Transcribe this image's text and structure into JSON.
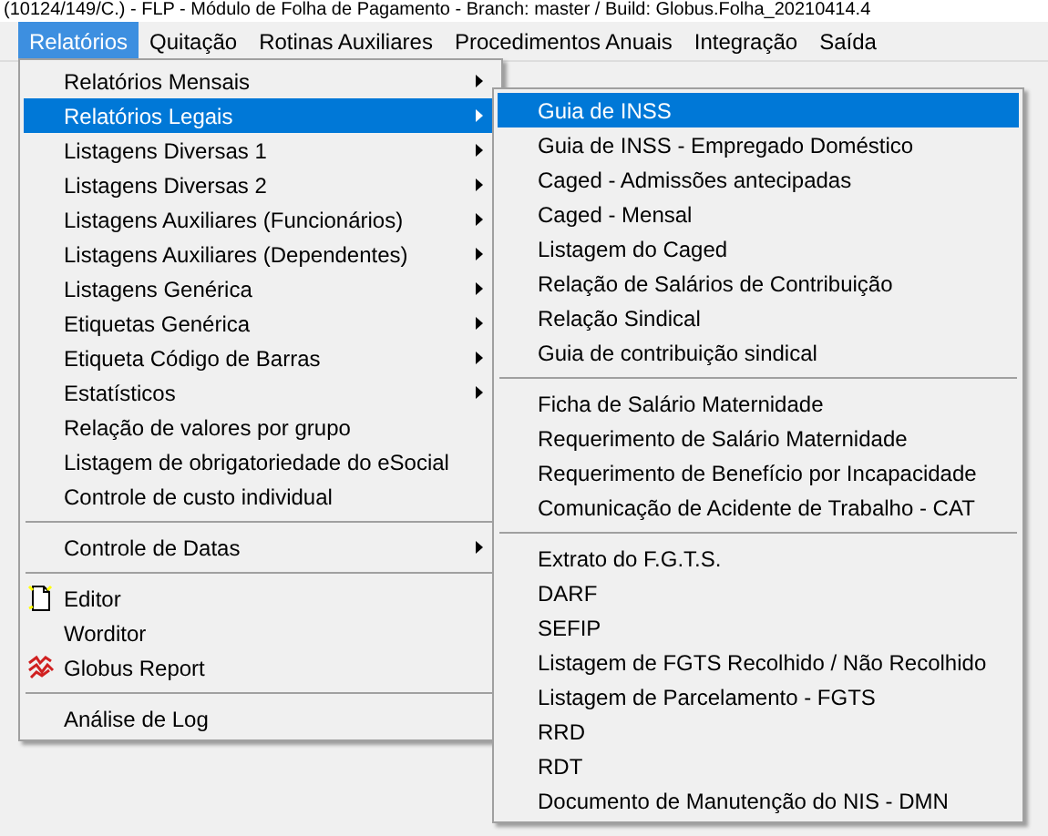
{
  "window": {
    "title": "(10124/149/C.) - FLP - Módulo de Folha de Pagamento - Branch: master / Build: Globus.Folha_20210414.4"
  },
  "menubar": [
    {
      "label": "Relatórios",
      "selected": true
    },
    {
      "label": "Quitação",
      "selected": false
    },
    {
      "label": "Rotinas Auxiliares",
      "selected": false
    },
    {
      "label": "Procedimentos Anuais",
      "selected": false
    },
    {
      "label": "Integração",
      "selected": false
    },
    {
      "label": "Saída",
      "selected": false
    }
  ],
  "menu": [
    {
      "kind": "submenu",
      "label": "Relatórios Mensais",
      "selected": false
    },
    {
      "kind": "submenu",
      "label": "Relatórios Legais",
      "selected": true
    },
    {
      "kind": "submenu",
      "label": "Listagens Diversas 1",
      "selected": false
    },
    {
      "kind": "submenu",
      "label": "Listagens Diversas 2",
      "selected": false
    },
    {
      "kind": "submenu",
      "label": "Listagens Auxiliares (Funcionários)",
      "selected": false
    },
    {
      "kind": "submenu",
      "label": "Listagens Auxiliares (Dependentes)",
      "selected": false
    },
    {
      "kind": "submenu",
      "label": "Listagens Genérica",
      "selected": false
    },
    {
      "kind": "submenu",
      "label": "Etiquetas Genérica",
      "selected": false
    },
    {
      "kind": "submenu",
      "label": "Etiqueta Código de Barras",
      "selected": false
    },
    {
      "kind": "submenu",
      "label": "Estatísticos",
      "selected": false
    },
    {
      "kind": "item",
      "label": "Relação de valores por grupo",
      "selected": false
    },
    {
      "kind": "item",
      "label": "Listagem de obrigatoriedade do eSocial",
      "selected": false
    },
    {
      "kind": "item",
      "label": "Controle de custo individual",
      "selected": false
    },
    {
      "kind": "separator"
    },
    {
      "kind": "submenu",
      "label": "Controle de Datas",
      "selected": false
    },
    {
      "kind": "separator"
    },
    {
      "kind": "document",
      "label": "Editor",
      "selected": false
    },
    {
      "kind": "item",
      "label": "Worditor",
      "selected": false
    },
    {
      "kind": "report",
      "label": "Globus Report",
      "selected": false
    },
    {
      "kind": "separator"
    },
    {
      "kind": "item",
      "label": "Análise de Log",
      "selected": false
    }
  ],
  "submenu": [
    {
      "kind": "item",
      "label": "Guia de INSS",
      "selected": true
    },
    {
      "kind": "item",
      "label": "Guia de INSS - Empregado Doméstico",
      "selected": false
    },
    {
      "kind": "item",
      "label": "Caged - Admissões antecipadas",
      "selected": false
    },
    {
      "kind": "item",
      "label": "Caged - Mensal",
      "selected": false
    },
    {
      "kind": "item",
      "label": "Listagem do Caged",
      "selected": false
    },
    {
      "kind": "item",
      "label": "Relação de Salários de Contribuição",
      "selected": false
    },
    {
      "kind": "item",
      "label": "Relação Sindical",
      "selected": false
    },
    {
      "kind": "item",
      "label": "Guia de contribuição sindical",
      "selected": false
    },
    {
      "kind": "separator"
    },
    {
      "kind": "item",
      "label": "Ficha de Salário Maternidade",
      "selected": false
    },
    {
      "kind": "item",
      "label": "Requerimento de Salário Maternidade",
      "selected": false
    },
    {
      "kind": "item",
      "label": "Requerimento de Benefício por Incapacidade",
      "selected": false
    },
    {
      "kind": "item",
      "label": "Comunicação de Acidente de Trabalho - CAT",
      "selected": false
    },
    {
      "kind": "separator"
    },
    {
      "kind": "item",
      "label": "Extrato do F.G.T.S.",
      "selected": false
    },
    {
      "kind": "item",
      "label": "DARF",
      "selected": false
    },
    {
      "kind": "item",
      "label": "SEFIP",
      "selected": false
    },
    {
      "kind": "item",
      "label": "Listagem de FGTS Recolhido / Não Recolhido",
      "selected": false
    },
    {
      "kind": "item",
      "label": "Listagem de Parcelamento - FGTS",
      "selected": false
    },
    {
      "kind": "item",
      "label": "RRD",
      "selected": false
    },
    {
      "kind": "item",
      "label": "RDT",
      "selected": false
    },
    {
      "kind": "item",
      "label": "Documento de Manutenção do NIS - DMN",
      "selected": false
    }
  ]
}
